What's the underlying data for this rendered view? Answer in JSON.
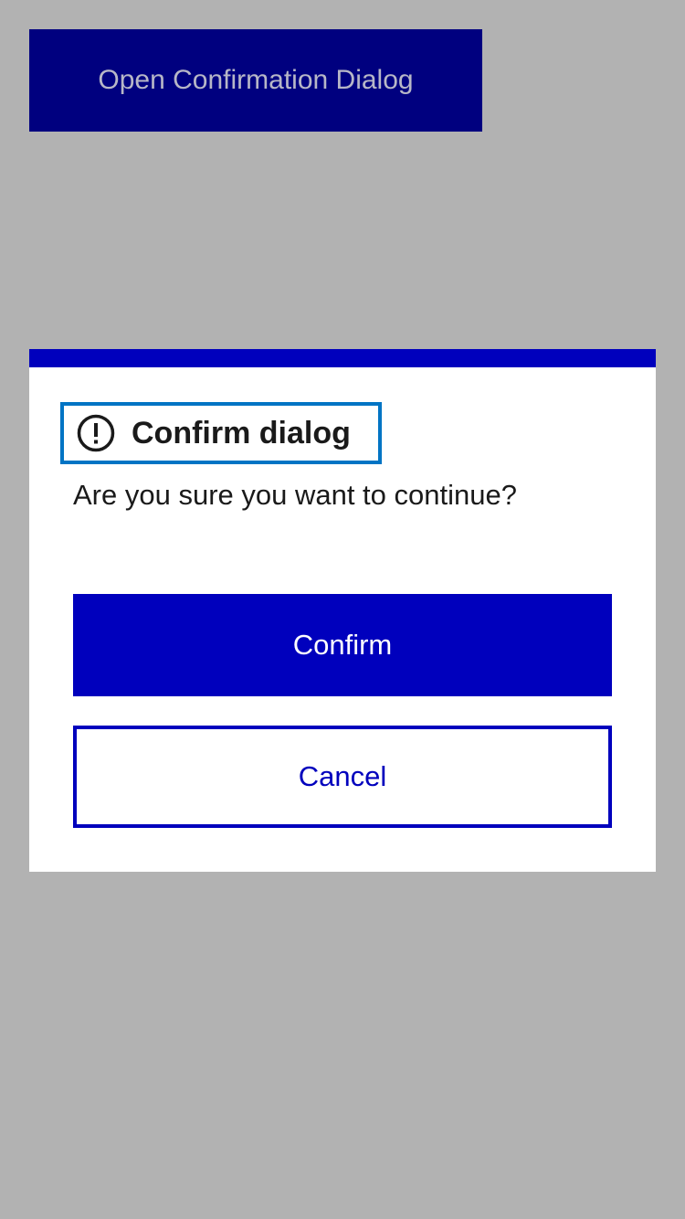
{
  "trigger": {
    "open_label": "Open Confirmation Dialog"
  },
  "dialog": {
    "title": "Confirm dialog",
    "title_icon": "alert-circle-icon",
    "message": "Are you sure you want to continue?",
    "confirm_label": "Confirm",
    "cancel_label": "Cancel"
  },
  "colors": {
    "backdrop": "#b2b2b2",
    "trigger_bg": "#00007f",
    "trigger_text": "#b7b7c7",
    "accent": "#0000bd",
    "focus_ring": "#0074c4",
    "text": "#1a1a1a",
    "surface": "#ffffff"
  }
}
